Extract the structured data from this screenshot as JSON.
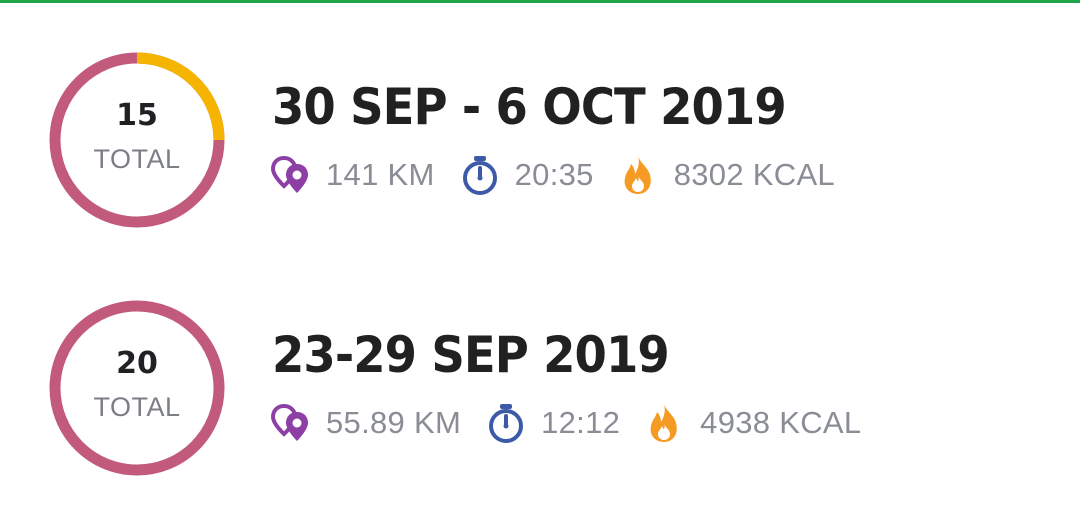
{
  "colors": {
    "top_bar": "#1fa64a",
    "ring_main": "#c25a7c",
    "ring_accent": "#f4b400",
    "distance_icon": "#8e3fa6",
    "timer_icon": "#3d5aa8",
    "calories_icon": "#f59a23"
  },
  "weeks": [
    {
      "count": "15",
      "count_label": "TOTAL",
      "title": "30 SEP - 6 OCT 2019",
      "distance": "141 KM",
      "duration": "20:35",
      "calories": "8302 KCAL",
      "ring_accent_fraction": 0.25
    },
    {
      "count": "20",
      "count_label": "TOTAL",
      "title": "23-29 SEP 2019",
      "distance": "55.89 KM",
      "duration": "12:12",
      "calories": "4938 KCAL",
      "ring_accent_fraction": 0
    }
  ],
  "icons": {
    "distance": "map-pin-icon",
    "duration": "stopwatch-icon",
    "calories": "flame-icon"
  }
}
